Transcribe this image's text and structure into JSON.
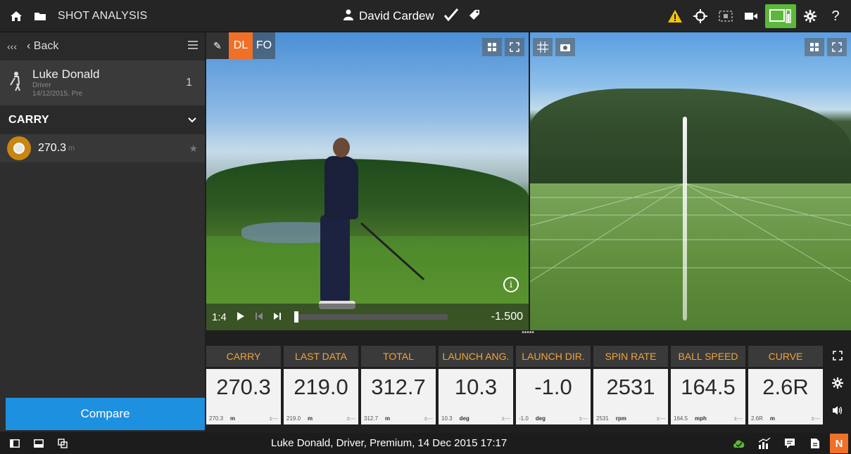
{
  "topbar": {
    "title": "SHOT ANALYSIS",
    "user": "David Cardew",
    "icons": [
      "home-icon",
      "folder-icon",
      "user-icon",
      "checkmark-icon",
      "tag-icon",
      "warning-icon",
      "crosshair-icon",
      "radar-icon",
      "camera-icon",
      "battery-icon",
      "gear-icon",
      "help-icon"
    ],
    "help_label": "?"
  },
  "sidebar": {
    "collapse_label": "‹‹‹",
    "back_label": "‹ Back",
    "player": {
      "name": "Luke Donald",
      "club": "Driver",
      "date": "14/12/2015, Pre",
      "count": "1"
    },
    "metric": "CARRY",
    "shots": [
      {
        "value": "270.3",
        "unit": "m"
      }
    ],
    "compare_label": "Compare"
  },
  "video": {
    "modes": {
      "dl": "DL",
      "fo": "FO"
    },
    "speed": "1:4",
    "time": "-1.500",
    "progress": 0.0
  },
  "splitter_label": "•••••",
  "tiles": [
    {
      "label": "CARRY",
      "value": "270.3",
      "small": "270.3",
      "unit": "m",
      "dev": "±---"
    },
    {
      "label": "LAST DATA",
      "value": "219.0",
      "small": "219.0",
      "unit": "m",
      "dev": "±---"
    },
    {
      "label": "TOTAL",
      "value": "312.7",
      "small": "312.7",
      "unit": "m",
      "dev": "±---"
    },
    {
      "label": "LAUNCH ANG.",
      "value": "10.3",
      "small": "10.3",
      "unit": "deg",
      "dev": "±---"
    },
    {
      "label": "LAUNCH DIR.",
      "value": "-1.0",
      "small": "-1.0",
      "unit": "deg",
      "dev": "±---"
    },
    {
      "label": "SPIN RATE",
      "value": "2531",
      "small": "2531",
      "unit": "rpm",
      "dev": "±---"
    },
    {
      "label": "BALL SPEED",
      "value": "164.5",
      "small": "164.5",
      "unit": "mph",
      "dev": "±---"
    },
    {
      "label": "CURVE",
      "value": "2.6R",
      "small": "2.6R",
      "unit": "m",
      "dev": "±---"
    }
  ],
  "statusbar": {
    "text": "Luke Donald, Driver, Premium, 14 Dec 2015 17:17",
    "badge": "N"
  },
  "colors": {
    "accent": "#f07028",
    "tile_label": "#f0a33a",
    "compare": "#1e90e0",
    "ball": "#c8860f",
    "battery": "#5cb83a",
    "warning": "#f5c400",
    "cloud": "#5cb83a"
  }
}
